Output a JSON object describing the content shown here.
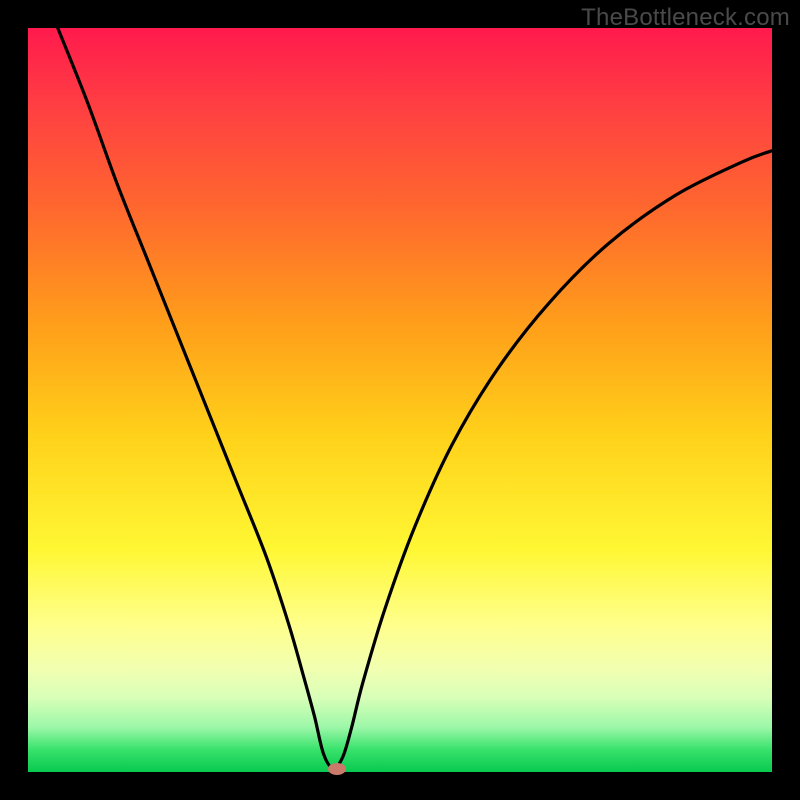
{
  "watermark": "TheBottleneck.com",
  "chart_data": {
    "type": "line",
    "title": "",
    "xlabel": "",
    "ylabel": "",
    "xlim": [
      0,
      100
    ],
    "ylim": [
      0,
      100
    ],
    "grid": false,
    "series": [
      {
        "name": "bottleneck-curve",
        "x": [
          4,
          8,
          12,
          16,
          20,
          24,
          28,
          32,
          35,
          37,
          38.5,
          39.7,
          41,
          42.3,
          43.5,
          45,
          48,
          52,
          57,
          63,
          70,
          78,
          87,
          96,
          100
        ],
        "y": [
          100,
          90,
          79,
          69,
          59,
          49,
          39,
          29,
          20,
          13,
          7.5,
          2.5,
          0.5,
          2,
          6,
          12,
          22,
          33,
          44,
          54,
          63,
          71,
          77.5,
          82,
          83.5
        ]
      }
    ],
    "marker": {
      "x": 41.5,
      "y": 0.4,
      "color": "#c97a6b"
    },
    "gradient_stops": [
      {
        "pos": 0,
        "color": "#ff1a4d"
      },
      {
        "pos": 25,
        "color": "#ff6a2d"
      },
      {
        "pos": 55,
        "color": "#ffd21a"
      },
      {
        "pos": 80,
        "color": "#ffff8a"
      },
      {
        "pos": 100,
        "color": "#08c94f"
      }
    ]
  }
}
